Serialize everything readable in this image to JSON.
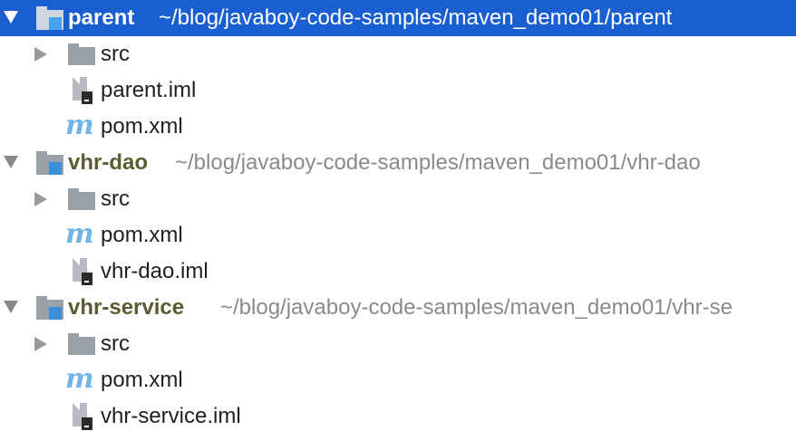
{
  "project_tree": {
    "parent": {
      "name": "parent",
      "path": "~/blog/javaboy-code-samples/maven_demo01/parent",
      "src": "src",
      "iml": "parent.iml",
      "pom": "pom.xml"
    },
    "vhr_dao": {
      "name": "vhr-dao",
      "path": "~/blog/javaboy-code-samples/maven_demo01/vhr-dao",
      "src": "src",
      "pom": "pom.xml",
      "iml": "vhr-dao.iml"
    },
    "vhr_service": {
      "name": "vhr-service",
      "path": "~/blog/javaboy-code-samples/maven_demo01/vhr-se",
      "src": "src",
      "pom": "pom.xml",
      "iml": "vhr-service.iml"
    },
    "maven_glyph": "m"
  },
  "colors": {
    "selection": "#1a5fd2",
    "module_label": "#5c5c32",
    "path_text": "#8a8a8a",
    "maven_icon": "#6fb5e8",
    "module_square": "#3a8fd6"
  },
  "icons": [
    "expand-arrow-icon",
    "collapse-arrow-icon",
    "module-folder-icon",
    "folder-icon",
    "iml-file-icon",
    "maven-pom-icon"
  ]
}
